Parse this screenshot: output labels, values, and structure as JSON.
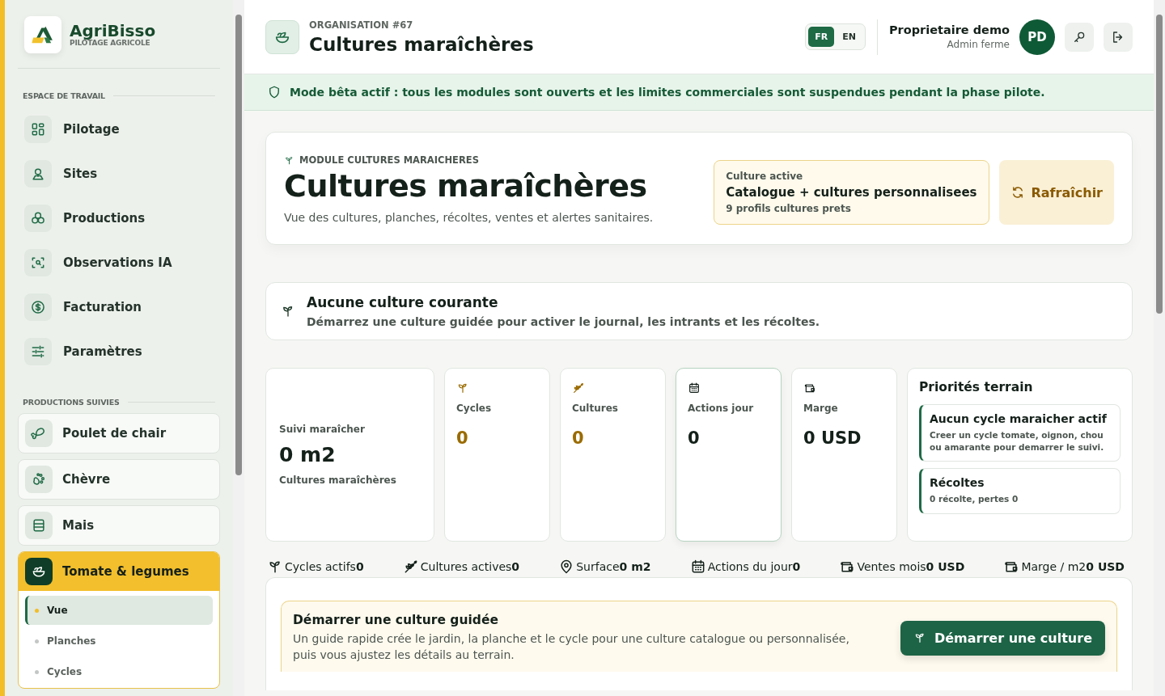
{
  "brand": {
    "name": "AgriBisso",
    "tagline": "PILOTAGE AGRICOLE"
  },
  "sidebar": {
    "workspace_title": "ESPACE DE TRAVAIL",
    "workspace_items": [
      {
        "label": "Pilotage",
        "selected": false
      },
      {
        "label": "Sites",
        "selected": false
      },
      {
        "label": "Productions",
        "selected": false
      },
      {
        "label": "Observations IA",
        "selected": false
      },
      {
        "label": "Facturation",
        "selected": false
      },
      {
        "label": "Paramètres",
        "selected": false
      }
    ],
    "productions_title": "PRODUCTIONS SUIVIES",
    "productions": [
      {
        "label": "Poulet de chair",
        "selected": false,
        "expanded": false
      },
      {
        "label": "Chèvre",
        "selected": false,
        "expanded": false
      },
      {
        "label": "Mais",
        "selected": false,
        "expanded": false
      },
      {
        "label": "Tomate & legumes",
        "selected": true,
        "expanded": true,
        "children": [
          {
            "label": "Vue",
            "selected": true
          },
          {
            "label": "Planches",
            "selected": false
          },
          {
            "label": "Cycles",
            "selected": false
          }
        ]
      }
    ]
  },
  "header": {
    "eyebrow": "ORGANISATION #67",
    "title": "Cultures maraîchères",
    "languages": [
      {
        "label": "FR",
        "selected": true
      },
      {
        "label": "EN",
        "selected": false
      }
    ],
    "user": {
      "name": "Proprietaire demo",
      "role": "Admin ferme",
      "initials": "PD"
    }
  },
  "banner": "Mode bêta actif : tous les modules sont ouverts et les limites commerciales sont suspendues pendant la phase pilote.",
  "hero": {
    "eyebrow": "MODULE CULTURES MARAICHERES",
    "title": "Cultures maraîchères",
    "subtitle": "Vue des cultures, planches, récoltes, ventes et alertes sanitaires.",
    "active": {
      "label": "Culture active",
      "value": "Catalogue + cultures personnalisees",
      "note": "9 profils cultures prets"
    },
    "refresh": "Rafraîchir"
  },
  "notice": {
    "title": "Aucune culture courante",
    "text": "Démarrez une culture guidée pour activer le journal, les intrants et les récoltes."
  },
  "summary": {
    "label": "Suivi maraîcher",
    "value": "0 m2",
    "caption": "Cultures maraîchères"
  },
  "stats": [
    {
      "label": "Cycles",
      "value": "0",
      "color": "#9a6b00",
      "selected": false
    },
    {
      "label": "Cultures",
      "value": "0",
      "color": "#9a6b00",
      "selected": false
    },
    {
      "label": "Actions jour",
      "value": "0",
      "color": "#14201a",
      "selected": true
    },
    {
      "label": "Marge",
      "value": "0 USD",
      "color": "#14201a",
      "selected": false
    }
  ],
  "priorities": {
    "title": "Priorités terrain",
    "items": [
      {
        "title": "Aucun cycle maraicher actif",
        "text": "Creer un cycle tomate, oignon, chou ou amarante pour demarrer le suivi."
      },
      {
        "title": "Récoltes",
        "text": "0 récolte, pertes 0"
      }
    ]
  },
  "metrics": [
    {
      "label": "Cycles actifs",
      "value": "0"
    },
    {
      "label": "Cultures actives",
      "value": "0"
    },
    {
      "label": "Surface",
      "value": "0 m2"
    },
    {
      "label": "Actions du jour",
      "value": "0"
    },
    {
      "label": "Ventes mois",
      "value": "0 USD"
    },
    {
      "label": "Marge / m2",
      "value": "0 USD"
    }
  ],
  "guide": {
    "title": "Démarrer une culture guidée",
    "text": "Un guide rapide crée le jardin, la planche et le cycle pour une culture catalogue ou personnalisée, puis vous ajustez les détails au terrain.",
    "button": "Démarrer une culture"
  }
}
